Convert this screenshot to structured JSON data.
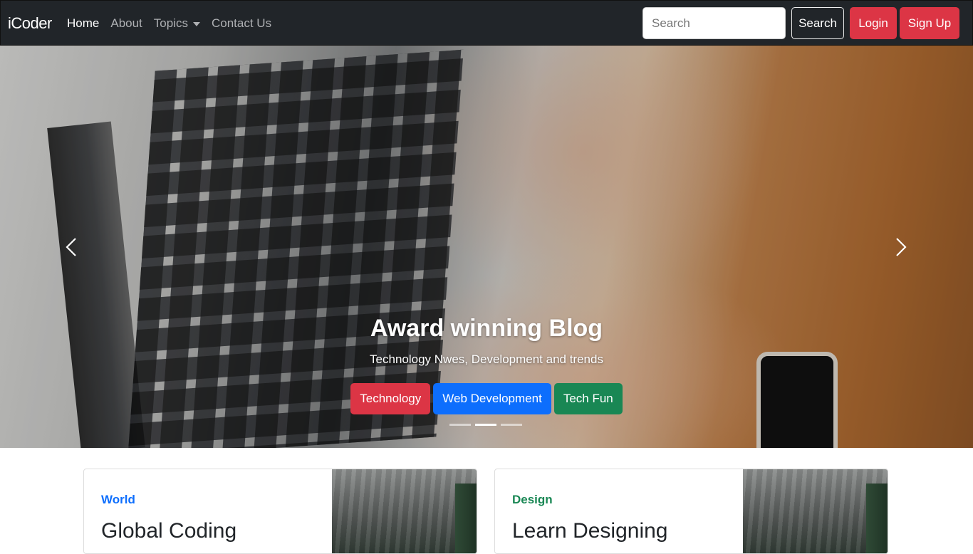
{
  "navbar": {
    "brand": "iCoder",
    "links": [
      {
        "label": "Home",
        "active": true
      },
      {
        "label": "About",
        "active": false
      },
      {
        "label": "Topics",
        "active": false,
        "dropdown": true
      },
      {
        "label": "Contact Us",
        "active": false
      }
    ],
    "search_placeholder": "Search",
    "search_button": "Search",
    "login_button": "Login",
    "signup_button": "Sign Up"
  },
  "carousel": {
    "title": "Award winning Blog",
    "subtitle": "Technology Nwes, Development and trends",
    "buttons": [
      {
        "label": "Technology",
        "color": "#dc3545"
      },
      {
        "label": "Web Development",
        "color": "#0d6efd"
      },
      {
        "label": "Tech Fun",
        "color": "#198754"
      }
    ],
    "indicator_count": 3,
    "active_indicator": 1
  },
  "cards": [
    {
      "category": "World",
      "category_color": "#0d6efd",
      "title": "Global Coding"
    },
    {
      "category": "Design",
      "category_color": "#198754",
      "title": "Learn Designing"
    }
  ],
  "colors": {
    "navbar_bg": "#212529",
    "danger": "#dc3545",
    "primary": "#0d6efd",
    "success": "#198754"
  },
  "icons": [
    "chevron-left-icon",
    "chevron-right-icon",
    "caret-down-icon"
  ]
}
